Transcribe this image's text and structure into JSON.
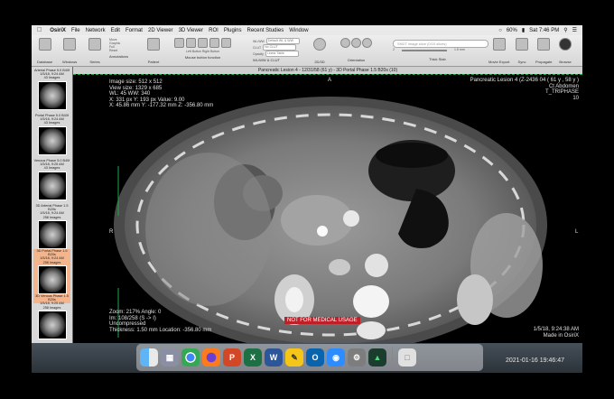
{
  "menubar": {
    "app_name": "OsiriX",
    "items": [
      "File",
      "Network",
      "Edit",
      "Format",
      "2D Viewer",
      "3D Viewer",
      "ROI",
      "Plugins",
      "Recent Studies",
      "Window"
    ],
    "battery": "60%",
    "clock": "Sat 7:46 PM"
  },
  "toolbar": {
    "groups": [
      "Database",
      "Windows",
      "Series",
      "Annotations",
      "Patient",
      "Mouse button function",
      "WL/WW & CLUT",
      "2D/3D",
      "Orientation",
      "Thick Slab",
      "Movie Export",
      "Sync",
      "Propagate",
      "Browse"
    ],
    "mini_options": [
      "Move",
      "Graphic",
      "Full",
      "Reset"
    ],
    "wlww_labels": [
      "WL/WW",
      "CLUT",
      "Opacity"
    ],
    "wlww_values": [
      "Default WL & WW",
      "No CLUT",
      "Linear Table"
    ],
    "thick_slab_values": [
      "2",
      "1.5 mm"
    ],
    "mouse_options": [
      "Left Button",
      "Right Button"
    ],
    "search_placeholder": "SNDT image slice (0/10 slices)"
  },
  "sidebar": {
    "series": [
      {
        "title": "Arterial Phase 5.0 B40f",
        "date": "1/5/18, 9:24 AM",
        "count": "43 Images",
        "selected": false
      },
      {
        "title": "Portal Phase 5.0 B40f",
        "date": "1/5/18, 9:24 AM",
        "count": "43 Images",
        "selected": false
      },
      {
        "title": "Venous Phase 5.0 B40f",
        "date": "1/5/18, 9:25 AM",
        "count": "43 Images",
        "selected": false
      },
      {
        "title": "3D Arterial Phase 1.5 B20s",
        "date": "1/5/18, 9:24 AM",
        "count": "258 Images",
        "selected": false
      },
      {
        "title": "3D Portal Phase 1.5 B20s",
        "date": "1/5/18, 9:24 AM",
        "count": "258 Images",
        "selected": true
      },
      {
        "title": "3D Venous Phase 1.5 B20s",
        "date": "1/5/18, 9:25 AM",
        "count": "258 Images",
        "selected": false
      }
    ]
  },
  "viewer": {
    "window_title": "Pancreatic Lesion 4 - 12/31/58 (61 y) - 3D Portal Phase 1.5 B20s (10)",
    "top_left": [
      "Image size: 512 x 512",
      "View size: 1329 x 685",
      "WL: 45 WW: 340",
      "X: 331 px Y: 193 px Value: 9.00",
      "X: 45.86 mm Y: -177.32 mm Z: -356.80 mm"
    ],
    "top_right": [
      "Pancreatic Lesion 4 (Z-2436 04 ( 61 y , 58 y )",
      "Ct Abdomen",
      "T_TRIPHASE",
      "10"
    ],
    "bottom_left": [
      "Zoom: 217% Angle: 0",
      "Im: 108/258 (S -> I)",
      "Uncompressed",
      "Thickness: 1.50 mm Location: -356.80 mm"
    ],
    "bottom_right": [
      "1/5/18, 9:24:38 AM",
      "Made in OsiriX"
    ],
    "orient_top": "A",
    "orient_left": "R",
    "orient_right": "L",
    "warning": "NOT FOR MEDICAL USAGE"
  },
  "dock": {
    "apps": [
      "Finder",
      "Launchpad",
      "Chrome",
      "Firefox",
      "PowerPoint",
      "Excel",
      "Word",
      "Notes",
      "Outlook",
      "Zoom",
      "System Preferences",
      "OsiriX"
    ],
    "trash": "Trash"
  },
  "timestamp": "2021-01-16 19:46:47",
  "colors": {
    "accent": "#1fa64b",
    "warning": "#c01f28",
    "selected": "#f5b58c"
  }
}
